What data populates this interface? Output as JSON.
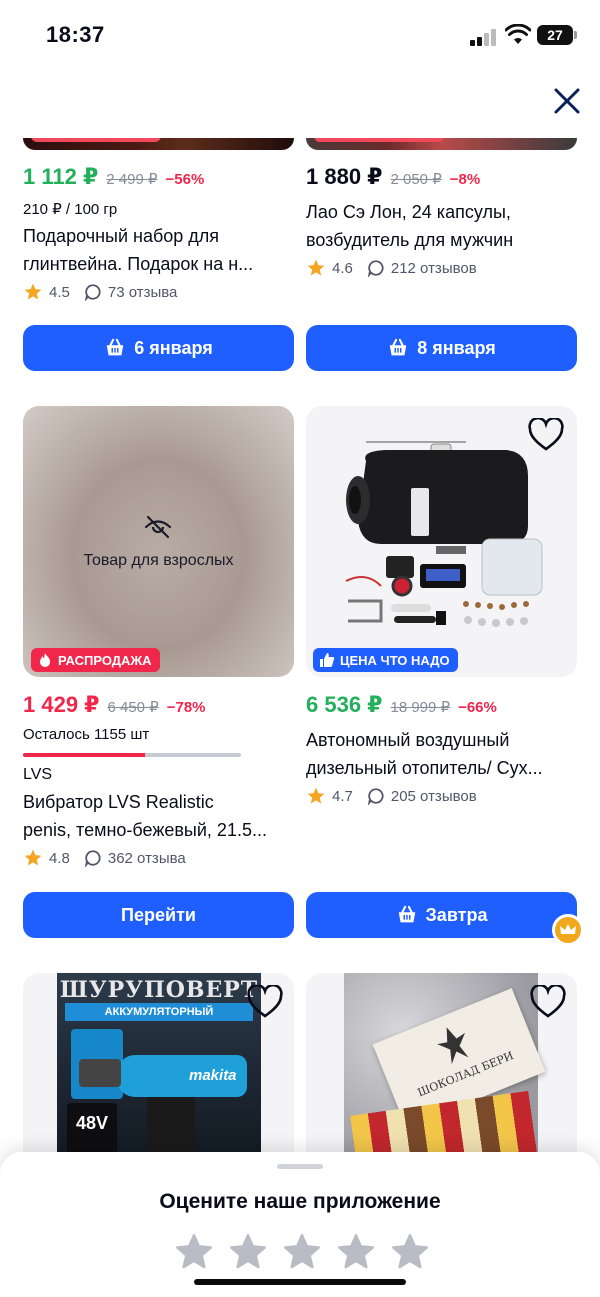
{
  "status_bar": {
    "time": "18:37",
    "battery": "27"
  },
  "products": [
    {
      "price": "1 112 ₽",
      "price_color": "#22b05a",
      "old_price": "2 499 ₽",
      "discount": "−56%",
      "unit_price": "210 ₽ / 100 гр",
      "title_line1": "Подарочный набор для",
      "title_line2": "глинтвейна. Подарок на н...",
      "rating": "4.5",
      "reviews": "73 отзыва",
      "button": "6 января"
    },
    {
      "price": "1 880 ₽",
      "price_color": "#0b0b1a",
      "old_price": "2 050 ₽",
      "discount": "−8%",
      "title_line1": "Лао Сэ Лон, 24 капсулы,",
      "title_line2": "возбудитель для мужчин",
      "rating": "4.6",
      "reviews": "212 отзывов",
      "button": "8 января"
    },
    {
      "image_text": "Товар для взрослых",
      "badge": "РАСПРОДАЖА",
      "price": "1 429 ₽",
      "price_color": "#f0264b",
      "old_price": "6 450 ₽",
      "discount": "−78%",
      "stock": "Осталось 1155 шт",
      "stock_fraction": 0.56,
      "brand": "LVS",
      "title_line1": "Вибратор LVS Realistic",
      "title_line2": "penis, темно-бежевый, 21.5...",
      "rating": "4.8",
      "reviews": "362 отзыва",
      "button": "Перейти"
    },
    {
      "badge": "ЦЕНА ЧТО НАДО",
      "price": "6 536 ₽",
      "price_color": "#22b05a",
      "old_price": "18 999 ₽",
      "discount": "−66%",
      "title_line1": "Автономный воздушный",
      "title_line2": "дизельный отопитель/ Сух...",
      "rating": "4.7",
      "reviews": "205 отзывов",
      "button": "Завтра"
    },
    {
      "image_title": "ШУРУПОВЕРТ",
      "image_subtitle": "АККУМУЛЯТОРНЫЙ",
      "image_volt": "48V",
      "image_brand": "makita"
    },
    {
      "image_brand": "ШОКОЛАД БЕРИ"
    }
  ],
  "rate_sheet": {
    "title": "Оцените наше приложение"
  },
  "colors": {
    "accent": "#1f5eff",
    "sale": "#f0264b",
    "green": "#22b05a",
    "star": "#f4a623"
  }
}
